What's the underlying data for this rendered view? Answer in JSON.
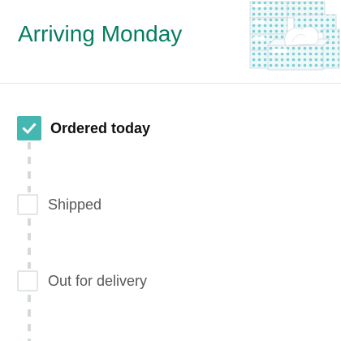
{
  "header": {
    "arrival_text": "Arriving Monday",
    "product_image_icon": "tissue-box-product-image"
  },
  "colors": {
    "accent_teal": "#067d62",
    "check_teal": "#44b7b0",
    "text_dark": "#0f1111",
    "text_muted": "#565959",
    "border_light": "#e3e6e6"
  },
  "tracking": {
    "steps": [
      {
        "label": "Ordered today",
        "completed": true,
        "icon": "check-icon"
      },
      {
        "label": "Shipped",
        "completed": false
      },
      {
        "label": "Out for delivery",
        "completed": false
      }
    ]
  }
}
